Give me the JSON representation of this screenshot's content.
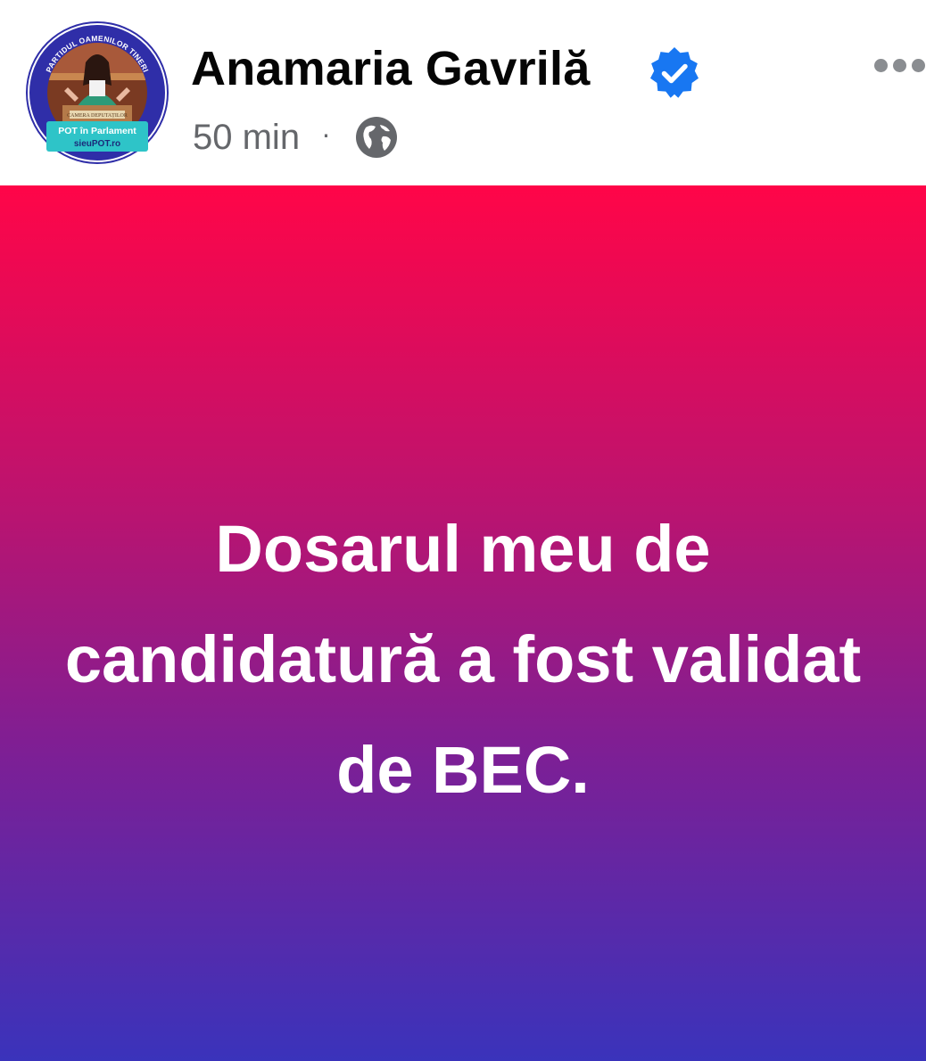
{
  "post": {
    "author": {
      "name": "Anamaria Gavrilă",
      "verified": true,
      "avatar_icon": "profile-photo-with-party-frame",
      "avatar_badge_ring_text": "PARTIDUL OAMENILOR TINERI",
      "avatar_badge_line1": "POT în Parlament",
      "avatar_badge_line2": "sieuPOT.ro",
      "avatar_sign_text": "CAMERA DEPUTAȚILOR"
    },
    "meta": {
      "time": "50 min",
      "separator": "·",
      "audience_icon": "globe-icon"
    },
    "menu_icon": "more-options-icon",
    "text": "Dosarul meu de candidatură a fost validat de BEC.",
    "colors": {
      "gradient_top": "#ff0548",
      "gradient_middle": "#7d1f95",
      "gradient_bottom": "#3a33bb",
      "verified_badge": "#1877f2",
      "avatar_frame": "#2f2ea8",
      "avatar_badge": "#2ec4c8"
    }
  }
}
